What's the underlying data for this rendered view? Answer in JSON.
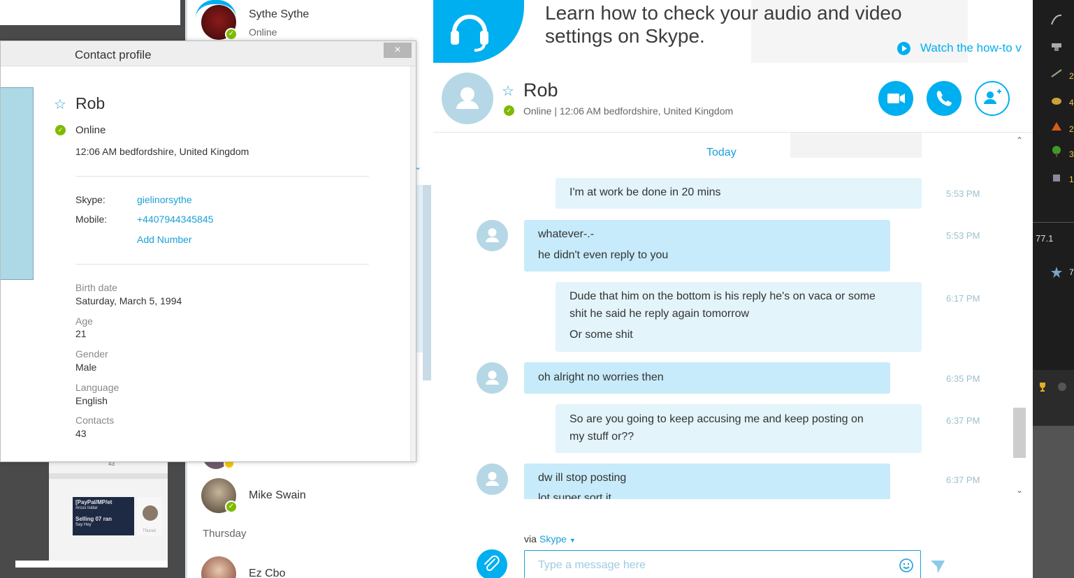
{
  "contacts": {
    "items": [
      {
        "name": "Sythe Sythe",
        "status": "Online"
      },
      {
        "name": "Mike Swain",
        "status": ""
      },
      {
        "name": "Ez Cbo",
        "status": ""
      }
    ],
    "day_label": "Thursday"
  },
  "background_thumbnail": {
    "count": "43",
    "line1": "[PayPal/MP/et",
    "line2": "Arcus Isidar",
    "line3": "Selling 07 ran",
    "line4": "Say Hey",
    "day": "Thursd"
  },
  "profile": {
    "window_title": "Contact profile",
    "close_label": "×",
    "name": "Rob",
    "status": "Online",
    "local_time": "12:06 AM bedfordshire, United Kingdom",
    "skype_label": "Skype:",
    "skype_id": "gielinorsythe",
    "mobile_label": "Mobile:",
    "mobile": "+4407944345845",
    "add_number": "Add Number",
    "fields": [
      {
        "label": "Birth date",
        "value": "Saturday, March 5, 1994"
      },
      {
        "label": "Age",
        "value": "21"
      },
      {
        "label": "Gender",
        "value": "Male"
      },
      {
        "label": "Language",
        "value": "English"
      },
      {
        "label": "Contacts",
        "value": "43"
      }
    ]
  },
  "banner": {
    "text": "Learn how to check your audio and video settings on Skype.",
    "link": "Watch the how-to v"
  },
  "chat_header": {
    "name": "Rob",
    "status": "Online  |  12:06 AM bedfordshire, United Kingdom"
  },
  "conversation": {
    "today": "Today",
    "messages": [
      {
        "lines": [
          "I'm at work be done in 20 mins"
        ],
        "time": "5:53 PM",
        "mine": true
      },
      {
        "lines": [
          "whatever-.-",
          "he didn't even reply to you"
        ],
        "time": "5:53 PM",
        "mine": false
      },
      {
        "lines": [
          "Dude that him on the bottom is his reply he's on vaca or some",
          "shit he said he reply again tomorrow",
          "Or some shit"
        ],
        "time": "6:17 PM",
        "mine": true
      },
      {
        "lines": [
          "oh alright no worries then"
        ],
        "time": "6:35 PM",
        "mine": false
      },
      {
        "lines": [
          "So are you going to keep accusing me and keep posting on",
          "my stuff or??"
        ],
        "time": "6:37 PM",
        "mine": true
      },
      {
        "lines": [
          "dw ill stop posting",
          "lot super sort it"
        ],
        "time": "6:37 PM",
        "mine": false
      }
    ]
  },
  "compose": {
    "via_label": "via",
    "via_service": "Skype",
    "placeholder": "Type a message here"
  },
  "game_sidebar": {
    "value1": "77.1",
    "numbers": [
      "2",
      "2",
      "4",
      "2",
      "3",
      "1",
      "7"
    ]
  },
  "colors": {
    "skype_blue": "#00aff0",
    "link_blue": "#1a9fd9",
    "online_green": "#7fba00",
    "bubble_incoming": "#c7ebfa",
    "bubble_outgoing": "#e3f4fb"
  }
}
